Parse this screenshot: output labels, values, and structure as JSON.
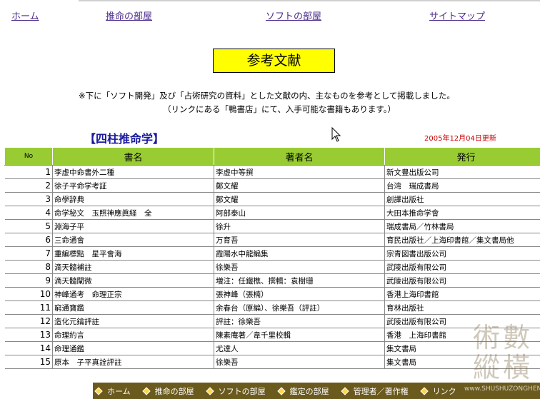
{
  "nav": {
    "home": "ホーム",
    "suimei": "推命の部屋",
    "soft": "ソフトの部屋",
    "sitemap": "サイトマップ"
  },
  "page_title": "参考文献",
  "notes": [
    "※下に「ソフト開発」及び「占術研究の資料」とした文献の内、主なものを参考として掲載しました。",
    "（リンクにある「鴨書店」にて、入手可能な書籍もあります。）"
  ],
  "section": {
    "title": "【四柱推命学】",
    "updated": "2005年12月04日更新"
  },
  "table": {
    "headers": [
      "No",
      "書名",
      "著者名",
      "発行"
    ],
    "rows": [
      [
        "1",
        "李虚中命書外二種",
        "李虚中等撰",
        "新文豊出版公司"
      ],
      [
        "2",
        "徐子平命学考証",
        "鄭文耀",
        "台湾　瑞成書局"
      ],
      [
        "3",
        "命學辞典",
        "鄭文耀",
        "創譯出版社"
      ],
      [
        "4",
        "命学秘文　玉照神應眞経　全",
        "阿部泰山",
        "大田本推命学會"
      ],
      [
        "5",
        "淵海子平",
        "徐升",
        "瑞成書局／竹林書局"
      ],
      [
        "6",
        "三命通會",
        "万育吾",
        "育民出版社／上海印書館／集文書局他"
      ],
      [
        "7",
        "重編標點　星平會海",
        "霞陽水中龍編集",
        "宗青図書出版公司"
      ],
      [
        "8",
        "滴天髓補註",
        "徐樂吾",
        "武陵出版有限公司"
      ],
      [
        "9",
        "滴天髓闡微",
        "増注：任鐵樵、撰輯：袁樹珊",
        "武陵出版有限公司"
      ],
      [
        "10",
        "神峰通考　命理正宗",
        "張神峰（張楠）",
        "香港上海印書館"
      ],
      [
        "11",
        "窮通寶鑑",
        "余春台（原編）、徐樂吾（評註）",
        "育林出版社"
      ],
      [
        "12",
        "造化元鑰評註",
        "評註：徐樂吾",
        "武陵出版有限公司"
      ],
      [
        "13",
        "命理約言",
        "陳素庵著／韋千里校輯",
        "香港　上海印書館"
      ],
      [
        "14",
        "命理通鑑",
        "尤達人",
        "集文書局"
      ],
      [
        "15",
        "原本　子平真詮評註",
        "徐樂吾",
        "集文書局"
      ]
    ]
  },
  "bottom_nav": [
    "ホーム",
    "推命の部屋",
    "ソフトの部屋",
    "鑑定の部屋",
    "管理者／著作権",
    "リンク"
  ],
  "watermark": {
    "lines": [
      "術數",
      "縱橫"
    ],
    "url": "www.SHUSHUZONGHENG.COM"
  },
  "colors": {
    "title_bg": "#ffff00",
    "header_bg": "#99cc33",
    "section_title": "#1a1aa0",
    "updated_text": "#cc0000",
    "bottom_bar": "#6b5a1e"
  }
}
